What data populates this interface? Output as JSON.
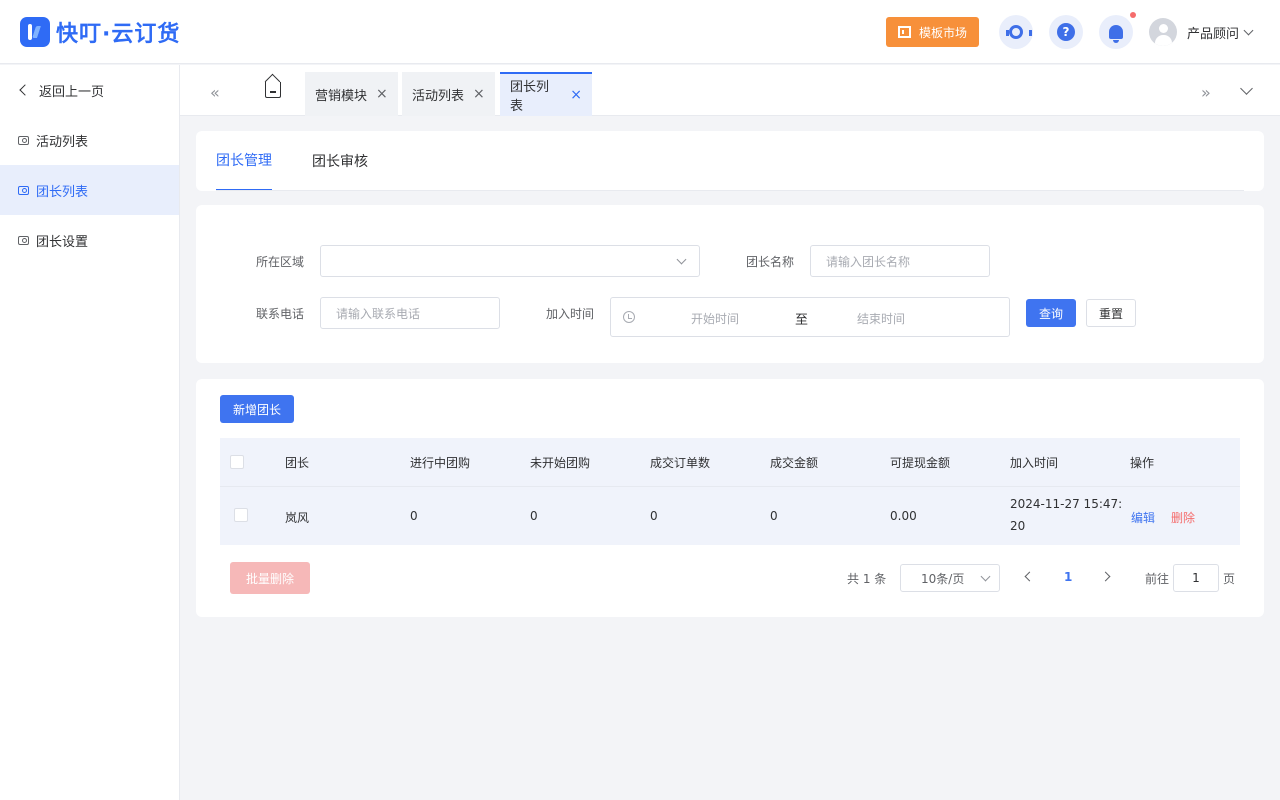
{
  "header": {
    "logo_text": "快叮·云订货",
    "template_market_label": "模板市场",
    "help_glyph": "?",
    "user_name": "产品顾问",
    "icons": [
      "service-icon",
      "help-icon",
      "bell-icon",
      "avatar"
    ]
  },
  "sidebar": {
    "back_label": "返回上一页",
    "items": [
      {
        "label": "活动列表",
        "active": false
      },
      {
        "label": "团长列表",
        "active": true
      },
      {
        "label": "团长设置",
        "active": false
      }
    ]
  },
  "tabs": {
    "scroll_left": "«",
    "scroll_right": "»",
    "close_glyph": "×",
    "items": [
      {
        "label": "营销模块",
        "active": false
      },
      {
        "label": "活动列表",
        "active": false
      },
      {
        "label": "团长列表",
        "active": true
      }
    ]
  },
  "sub_tabs": [
    {
      "label": "团长管理",
      "active": true
    },
    {
      "label": "团长审核",
      "active": false
    }
  ],
  "filters": {
    "region_label": "所在区域",
    "region_value": "",
    "leader_name_label": "团长名称",
    "leader_name_placeholder": "请输入团长名称",
    "phone_label": "联系电话",
    "phone_placeholder": "请输入联系电话",
    "join_time_label": "加入时间",
    "start_placeholder": "开始时间",
    "range_separator": "至",
    "end_placeholder": "结束时间",
    "search_label": "查询",
    "reset_label": "重置"
  },
  "table": {
    "add_button": "新增团长",
    "columns": [
      "团长",
      "进行中团购",
      "未开始团购",
      "成交订单数",
      "成交金额",
      "可提现金额",
      "加入时间",
      "操作"
    ],
    "rows": [
      {
        "leader": "岚风",
        "ongoing": "0",
        "not_started": "0",
        "orders": "0",
        "amount": "0",
        "withdrawable": "0.00",
        "join_time_line1": "2024-11-27 15:47:",
        "join_time_line2": "20",
        "edit": "编辑",
        "delete": "删除"
      }
    ],
    "batch_delete": "批量删除"
  },
  "pagination": {
    "total_text": "共 1 条",
    "page_size": "10条/页",
    "current_page": "1",
    "goto_label": "前往",
    "goto_value": "1",
    "page_suffix": "页"
  },
  "colors": {
    "primary": "#3f74f0",
    "brand": "#2f6bf5",
    "warning": "#f7903a",
    "danger": "#f56c6c"
  }
}
